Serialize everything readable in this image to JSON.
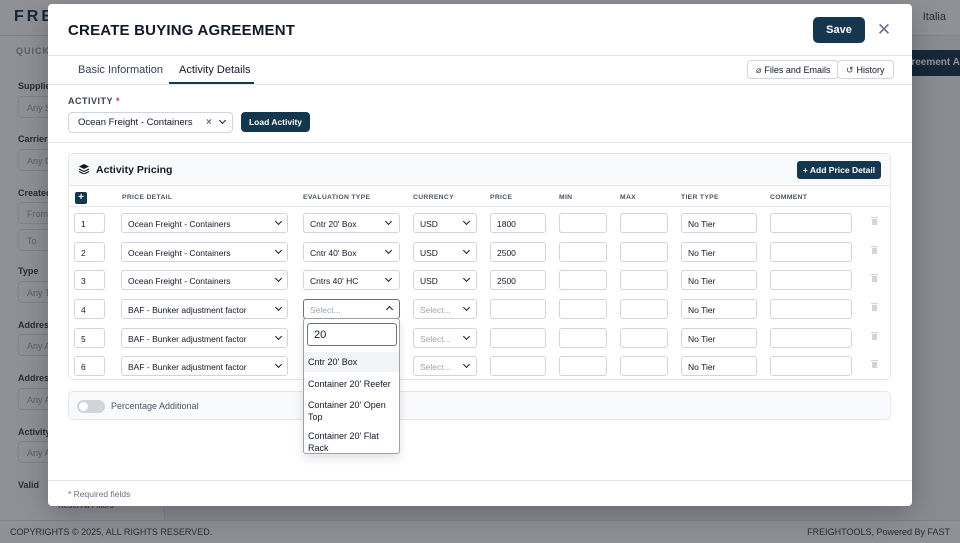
{
  "background": {
    "logo": "FRE",
    "user": "Italia",
    "quick": "QUICK F",
    "filters": [
      {
        "label": "Supplier",
        "placeholder": "Any S"
      },
      {
        "label": "Carrier",
        "placeholder": "Any C"
      },
      {
        "label": "Created",
        "placeholder": "From"
      },
      {
        "label": "",
        "placeholder": "To"
      },
      {
        "label": "Type",
        "placeholder": "Any T"
      },
      {
        "label": "Address",
        "placeholder": "Any A"
      },
      {
        "label": "Address",
        "placeholder": "Any A"
      },
      {
        "label": "Activity",
        "placeholder": "Any A"
      },
      {
        "label": "Valid",
        "placeholder": ""
      }
    ],
    "agreement_button": "Agreement A",
    "reset": "Reset All Filters",
    "footer_left": "COPYRIGHTS © 2025, ALL RIGHTS RESERVED.",
    "footer_right": "FREIGHTOOLS, Powered By FAST"
  },
  "modal": {
    "title": "CREATE BUYING AGREEMENT",
    "save_label": "Save",
    "close_glyph": "✕",
    "tabs": [
      {
        "label": "Basic Information",
        "active": false
      },
      {
        "label": "Activity Details",
        "active": true
      }
    ],
    "files_label": "Files and Emails",
    "history_label": "History",
    "activity_label": "ACTIVITY",
    "required_mark": "*",
    "activity_value": "Ocean Freight - Containers",
    "load_activity_label": "Load Activity",
    "pricing": {
      "title": "Activity Pricing",
      "add_price_label": "+ Add Price Detail",
      "add_row_glyph": "+",
      "columns": [
        "PRICE DETAIL",
        "EVALUATION TYPE",
        "CURRENCY",
        "PRICE",
        "MIN",
        "MAX",
        "TIER TYPE",
        "COMMENT"
      ],
      "rows": [
        {
          "index": "1",
          "price_detail": "Ocean Freight - Containers",
          "evaluation_type": "Cntr 20' Box",
          "currency": "USD",
          "price": "1800",
          "min": "",
          "max": "",
          "tier_type": "No Tier",
          "comment": ""
        },
        {
          "index": "2",
          "price_detail": "Ocean Freight - Containers",
          "evaluation_type": "Cntr 40' Box",
          "currency": "USD",
          "price": "2500",
          "min": "",
          "max": "",
          "tier_type": "No Tier",
          "comment": ""
        },
        {
          "index": "3",
          "price_detail": "Ocean Freight - Containers",
          "evaluation_type": "Cntrs 40' HC",
          "currency": "USD",
          "price": "2500",
          "min": "",
          "max": "",
          "tier_type": "No Tier",
          "comment": ""
        },
        {
          "index": "4",
          "price_detail": "BAF - Bunker adjustment factor",
          "evaluation_type": "Select...",
          "currency": "Select...",
          "price": "",
          "min": "",
          "max": "",
          "tier_type": "No Tier",
          "comment": ""
        },
        {
          "index": "5",
          "price_detail": "BAF - Bunker adjustment factor",
          "evaluation_type": "",
          "currency": "Select...",
          "price": "",
          "min": "",
          "max": "",
          "tier_type": "No Tier",
          "comment": ""
        },
        {
          "index": "6",
          "price_detail": "BAF - Bunker adjustment factor",
          "evaluation_type": "",
          "currency": "Select...",
          "price": "",
          "min": "",
          "max": "",
          "tier_type": "No Tier",
          "comment": ""
        }
      ]
    },
    "percentage_label": "Percentage Additional",
    "required_note": "* Required fields"
  },
  "dropdown": {
    "search_value": "20",
    "options": [
      "Cntr 20' Box",
      "Container 20' Reefer",
      "Container 20' Open Top",
      "Container 20' Flat Rack"
    ]
  },
  "colors": {
    "primary": "#14364e",
    "required": "#dc2626"
  }
}
